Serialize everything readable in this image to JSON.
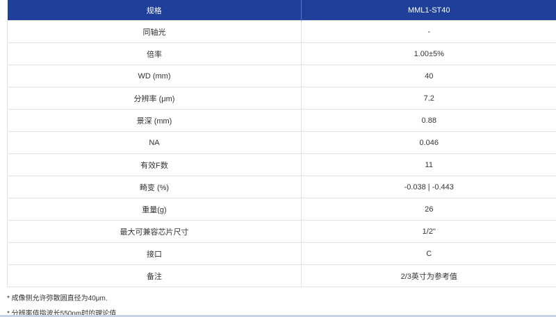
{
  "table": {
    "headers": [
      "规格",
      "MML1-ST40"
    ],
    "rows": [
      [
        "同轴光",
        "-"
      ],
      [
        "倍率",
        "1.00±5%"
      ],
      [
        "WD (mm)",
        "40"
      ],
      [
        "分辨率 (μm)",
        "7.2"
      ],
      [
        "景深 (mm)",
        "0.88"
      ],
      [
        "NA",
        "0.046"
      ],
      [
        "有效F数",
        "11"
      ],
      [
        "畸变 (%)",
        "-0.038 | -0.443"
      ],
      [
        "重量(g)",
        "26"
      ],
      [
        "最大可兼容芯片尺寸",
        "1/2\""
      ],
      [
        "接口",
        "C"
      ],
      [
        "备注",
        "2/3英寸为参考值"
      ]
    ]
  },
  "notes": [
    "* 成像侧允许弥散圆直径为40μm.",
    "* 分辨率值指波长550nm时的理论值."
  ],
  "colors": {
    "header_bg": "#1e3f9a",
    "header_text": "#ffffff",
    "border": "#e2e2e2"
  }
}
